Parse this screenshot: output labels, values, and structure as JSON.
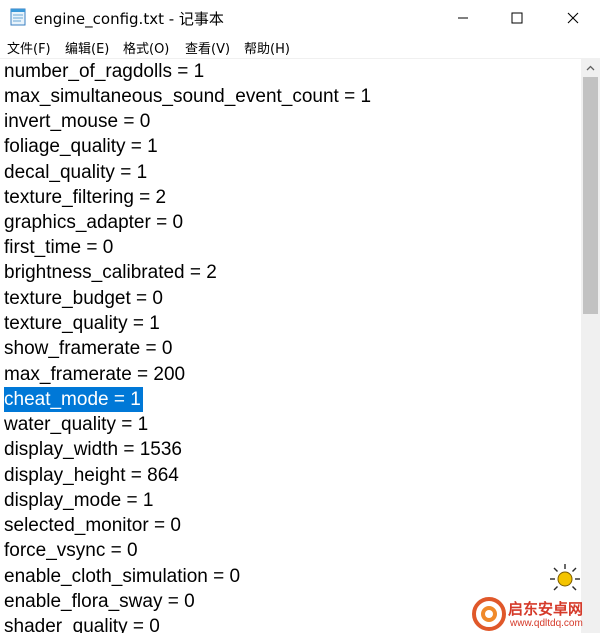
{
  "window": {
    "title": "engine_config.txt - 记事本",
    "minimize_icon": "minimize-icon",
    "maximize_icon": "maximize-icon",
    "close_icon": "close-icon"
  },
  "menu": {
    "items": [
      {
        "label": "文件(F)"
      },
      {
        "label": "编辑(E)"
      },
      {
        "label": "格式(O)"
      },
      {
        "label": "查看(V)"
      },
      {
        "label": "帮助(H)"
      }
    ]
  },
  "editor": {
    "selected_line_index": 13,
    "selection_color": "#0078d7",
    "lines": [
      "number_of_ragdolls = 1",
      "max_simultaneous_sound_event_count = 1",
      "invert_mouse = 0",
      "foliage_quality = 1",
      "decal_quality = 1",
      "texture_filtering = 2",
      "graphics_adapter = 0",
      "first_time = 0",
      "brightness_calibrated = 2",
      "texture_budget = 0",
      "texture_quality = 1",
      "show_framerate = 0",
      "max_framerate = 200",
      "cheat_mode = 1",
      "water_quality = 1",
      "display_width = 1536",
      "display_height = 864",
      "display_mode = 1",
      "selected_monitor = 0",
      "force_vsync = 0",
      "enable_cloth_simulation = 0",
      "enable_flora_sway = 0",
      "shader_quality = 0"
    ]
  },
  "watermark": {
    "main": "启东安卓网",
    "sub": "www.qdltdq.com",
    "color": "#d53a2a"
  }
}
